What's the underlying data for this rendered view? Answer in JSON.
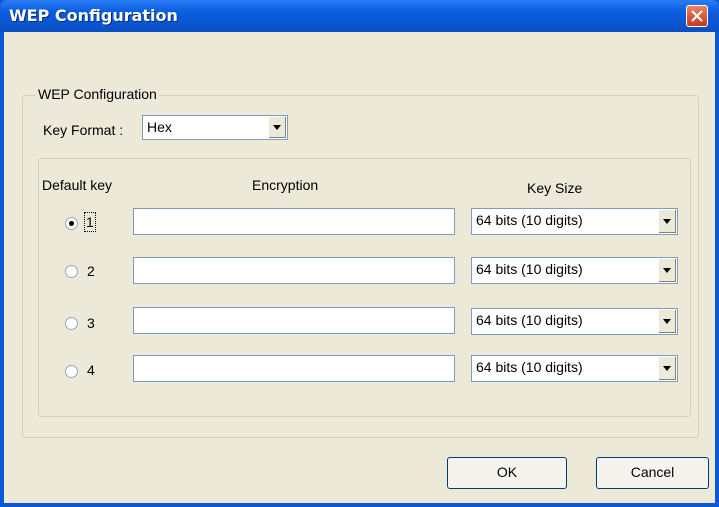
{
  "window": {
    "title": "WEP Configuration"
  },
  "group": {
    "legend": "WEP Configuration"
  },
  "key_format": {
    "label": "Key Format :",
    "value": "Hex"
  },
  "columns": {
    "default_key": "Default key",
    "encryption": "Encryption",
    "key_size": "Key Size"
  },
  "keys": [
    {
      "number": "1",
      "selected": true,
      "encryption": "",
      "key_size": "64 bits (10 digits)"
    },
    {
      "number": "2",
      "selected": false,
      "encryption": "",
      "key_size": "64 bits (10 digits)"
    },
    {
      "number": "3",
      "selected": false,
      "encryption": "",
      "key_size": "64 bits (10 digits)"
    },
    {
      "number": "4",
      "selected": false,
      "encryption": "",
      "key_size": "64 bits (10 digits)"
    }
  ],
  "buttons": {
    "ok": "OK",
    "cancel": "Cancel"
  }
}
